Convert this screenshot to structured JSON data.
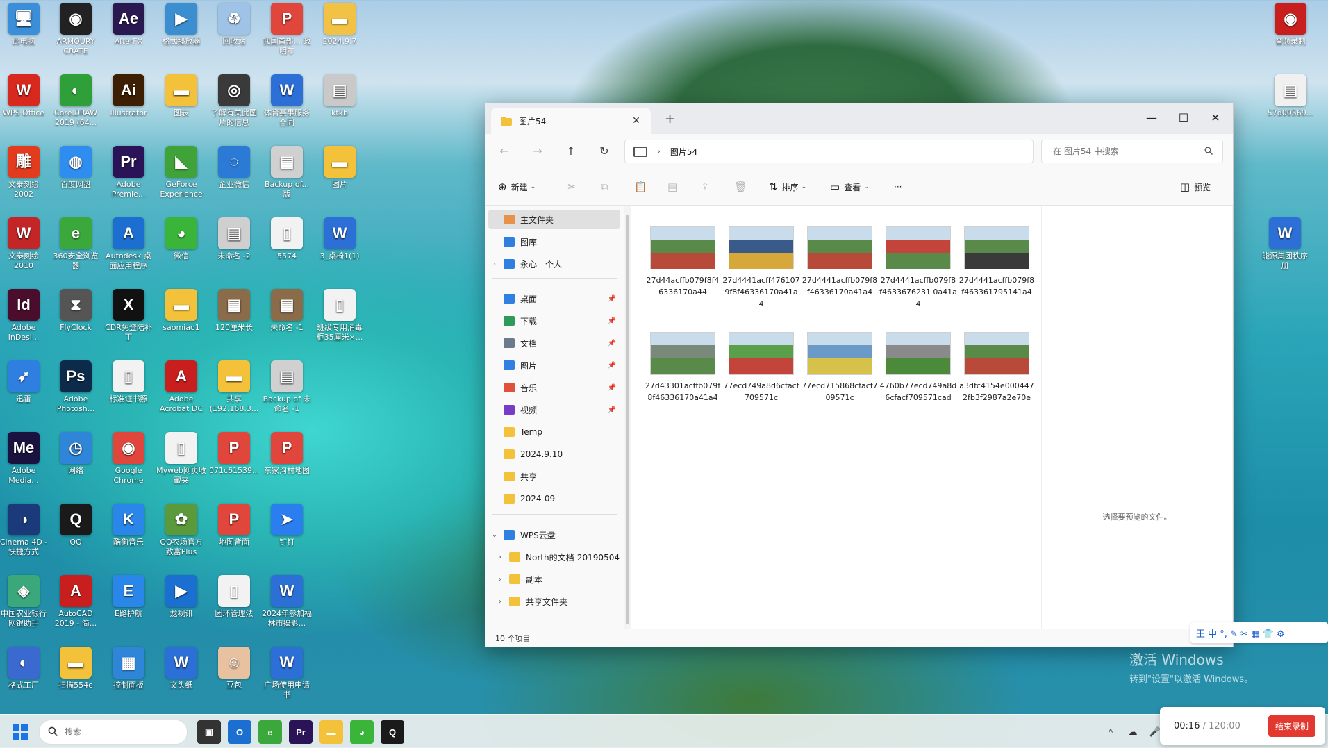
{
  "desktop": {
    "icons": [
      {
        "label": "此电脑",
        "glyph": "🖥",
        "color": "#3a8fd8"
      },
      {
        "label": "ARMOURY CRATE",
        "glyph": "◉",
        "color": "#222222"
      },
      {
        "label": "AfterFX",
        "glyph": "Ae",
        "color": "#2a1850"
      },
      {
        "label": "格式播放器",
        "glyph": "▶",
        "color": "#3b8fd0"
      },
      {
        "label": "回收站",
        "glyph": "♻",
        "color": "#9fc3e6"
      },
      {
        "label": "我国首部... 政 明年",
        "glyph": "P",
        "color": "#e0463c"
      },
      {
        "label": "2024.9.7",
        "glyph": "▬",
        "color": "#f2c244"
      },
      {
        "label": "WPS Office",
        "glyph": "W",
        "color": "#d8291f"
      },
      {
        "label": "CorelDRAW 2019 (64...",
        "glyph": "◐",
        "color": "#2f9f3a"
      },
      {
        "label": "Illustrator",
        "glyph": "Ai",
        "color": "#3d1f04"
      },
      {
        "label": "图表",
        "glyph": "▬",
        "color": "#f3c13a"
      },
      {
        "label": "了解有关此图片的信息",
        "glyph": "◎",
        "color": "#3a3a3a"
      },
      {
        "label": "体育赛事服务合同",
        "glyph": "W",
        "color": "#2c6fd6"
      },
      {
        "label": "ktkb",
        "glyph": "▤",
        "color": "#c9c9c9"
      },
      {
        "label": "文泰刻绘 2002",
        "glyph": "雕",
        "color": "#e33b1d"
      },
      {
        "label": "百度网盘",
        "glyph": "◍",
        "color": "#2f8df0"
      },
      {
        "label": "Adobe Premie...",
        "glyph": "Pr",
        "color": "#2a1457"
      },
      {
        "label": "GeForce Experience",
        "glyph": "◣",
        "color": "#3fa33a"
      },
      {
        "label": "企业微信",
        "glyph": "◌",
        "color": "#2b7ad6"
      },
      {
        "label": "Backup of... 版",
        "glyph": "▤",
        "color": "#d0d0d0"
      },
      {
        "label": "图片",
        "glyph": "▬",
        "color": "#f3c13a"
      },
      {
        "label": "文泰刻绘 2010",
        "glyph": "W",
        "color": "#c42628"
      },
      {
        "label": "360安全浏览器",
        "glyph": "e",
        "color": "#3aa83a"
      },
      {
        "label": "Autodesk 桌面应用程序",
        "glyph": "A",
        "color": "#1c6fd0"
      },
      {
        "label": "微信",
        "glyph": "◕",
        "color": "#3ab53a"
      },
      {
        "label": "未命名 -2",
        "glyph": "▤",
        "color": "#cfcfcf"
      },
      {
        "label": "5574",
        "glyph": "▯",
        "color": "#f2f2f2"
      },
      {
        "label": "3_桌椅1(1)",
        "glyph": "W",
        "color": "#2c6fd6"
      },
      {
        "label": "Adobe InDesi...",
        "glyph": "Id",
        "color": "#4a0d2b"
      },
      {
        "label": "FlyClock",
        "glyph": "⧗",
        "color": "#555555"
      },
      {
        "label": "CDR免登陆补丁",
        "glyph": "X",
        "color": "#111111"
      },
      {
        "label": "saomiao1",
        "glyph": "▬",
        "color": "#f3c13a"
      },
      {
        "label": "120厘米长",
        "glyph": "▤",
        "color": "#8a6b4a"
      },
      {
        "label": "未命名 -1",
        "glyph": "▤",
        "color": "#8a6b4a"
      },
      {
        "label": "班级专用消毒柜35厘米×...",
        "glyph": "▯",
        "color": "#f2f2f2"
      },
      {
        "label": "迅雷",
        "glyph": "➶",
        "color": "#2f7fe0"
      },
      {
        "label": "Adobe Photosh...",
        "glyph": "Ps",
        "color": "#0c2a4a"
      },
      {
        "label": "标准证书照",
        "glyph": "▯",
        "color": "#f2f2f2"
      },
      {
        "label": "Adobe Acrobat DC",
        "glyph": "A",
        "color": "#c81e1e"
      },
      {
        "label": "共享 (192.168.3...",
        "glyph": "▬",
        "color": "#f3c13a"
      },
      {
        "label": "Backup of 未命名 -1",
        "glyph": "▤",
        "color": "#d0d0d0"
      },
      {
        "label": "Adobe Media...",
        "glyph": "Me",
        "color": "#1a1340"
      },
      {
        "label": "网络",
        "glyph": "◷",
        "color": "#2f85d8"
      },
      {
        "label": "Google Chrome",
        "glyph": "◉",
        "color": "#e0463c"
      },
      {
        "label": "Myweb网页收藏夹",
        "glyph": "▯",
        "color": "#f2f2f2"
      },
      {
        "label": "071c61539...",
        "glyph": "P",
        "color": "#e0463c"
      },
      {
        "label": "东家沟村地图",
        "glyph": "P",
        "color": "#e0463c"
      },
      {
        "label": "Cinema 4D - 快捷方式",
        "glyph": "◑",
        "color": "#1a3a7a"
      },
      {
        "label": "QQ",
        "glyph": "Q",
        "color": "#1a1a1a"
      },
      {
        "label": "酷狗音乐",
        "glyph": "K",
        "color": "#2a86e8"
      },
      {
        "label": "QQ农场官方致富Plus",
        "glyph": "✿",
        "color": "#5a9a3a"
      },
      {
        "label": "地图背面",
        "glyph": "P",
        "color": "#e0463c"
      },
      {
        "label": "钉钉",
        "glyph": "➤",
        "color": "#2a7ef0"
      },
      {
        "label": "中国农业银行网银助手",
        "glyph": "◈",
        "color": "#3aa87a"
      },
      {
        "label": "AutoCAD 2019 - 简...",
        "glyph": "A",
        "color": "#c81e1e"
      },
      {
        "label": "E路护航",
        "glyph": "E",
        "color": "#2a86e8"
      },
      {
        "label": "龙视讯",
        "glyph": "▶",
        "color": "#1a6fd0"
      },
      {
        "label": "团环管理法",
        "glyph": "▯",
        "color": "#f2f2f2"
      },
      {
        "label": "2024年参加福林市摄影...",
        "glyph": "W",
        "color": "#2c6fd6"
      },
      {
        "label": "格式工厂",
        "glyph": "◐",
        "color": "#3a6ad0"
      },
      {
        "label": "扫描554e",
        "glyph": "▬",
        "color": "#f3c13a"
      },
      {
        "label": "控制面板",
        "glyph": "▦",
        "color": "#2f85d8"
      },
      {
        "label": "文头纸",
        "glyph": "W",
        "color": "#2c6fd6"
      },
      {
        "label": "豆包",
        "glyph": "☺",
        "color": "#e8c2a0"
      },
      {
        "label": "广场使用申请书",
        "glyph": "W",
        "color": "#2c6fd6"
      },
      {
        "label": "音频录制",
        "glyph": "◉",
        "color": "#c81e1e"
      },
      {
        "label": "57d00569...",
        "glyph": "▤",
        "color": "#f0f0f0"
      },
      {
        "label": "能源集团秩序册",
        "glyph": "W",
        "color": "#2c6fd6"
      }
    ]
  },
  "explorer": {
    "tab_title": "图片54",
    "address_path": "图片54",
    "search_placeholder": "在 图片54 中搜索",
    "toolbar": {
      "new_label": "新建",
      "sort_label": "排序",
      "view_label": "查看",
      "more_label": "···",
      "preview_label": "预览"
    },
    "sidebar": [
      {
        "label": "主文件夹",
        "icon": "home-icon",
        "color": "#e8914a",
        "chev": "",
        "pin": false,
        "selected": true
      },
      {
        "label": "图库",
        "icon": "gallery-icon",
        "color": "#2f7fe0",
        "chev": "",
        "pin": false,
        "selected": false
      },
      {
        "label": "永心 - 个人",
        "icon": "onedrive-icon",
        "color": "#2f7fe0",
        "chev": "›",
        "pin": false,
        "selected": false
      },
      {
        "label": "桌面",
        "icon": "desktop-icon",
        "color": "#2f7fe0",
        "chev": "",
        "pin": true,
        "selected": false
      },
      {
        "label": "下载",
        "icon": "download-icon",
        "color": "#2e9a5a",
        "chev": "",
        "pin": true,
        "selected": false
      },
      {
        "label": "文档",
        "icon": "documents-icon",
        "color": "#6a7a8a",
        "chev": "",
        "pin": true,
        "selected": false
      },
      {
        "label": "图片",
        "icon": "pictures-icon",
        "color": "#2f7fe0",
        "chev": "",
        "pin": true,
        "selected": false
      },
      {
        "label": "音乐",
        "icon": "music-icon",
        "color": "#e0503a",
        "chev": "",
        "pin": true,
        "selected": false
      },
      {
        "label": "视频",
        "icon": "videos-icon",
        "color": "#7a3ac8",
        "chev": "",
        "pin": true,
        "selected": false
      },
      {
        "label": "Temp",
        "icon": "folder-icon",
        "color": "#f3c13a",
        "chev": "",
        "pin": false,
        "selected": false
      },
      {
        "label": "2024.9.10",
        "icon": "folder-icon",
        "color": "#f3c13a",
        "chev": "",
        "pin": false,
        "selected": false
      },
      {
        "label": "共享",
        "icon": "folder-icon",
        "color": "#f3c13a",
        "chev": "",
        "pin": false,
        "selected": false
      },
      {
        "label": "2024-09",
        "icon": "folder-icon",
        "color": "#f3c13a",
        "chev": "",
        "pin": false,
        "selected": false
      },
      {
        "label": "WPS云盘",
        "icon": "cloud-icon",
        "color": "#2f7fe0",
        "chev": "⌄",
        "pin": false,
        "selected": false
      },
      {
        "label": "North的文档-20190504",
        "icon": "folder-icon",
        "color": "#f3c13a",
        "chev": "›",
        "pin": false,
        "selected": false
      },
      {
        "label": "副本",
        "icon": "folder-icon",
        "color": "#f3c13a",
        "chev": "›",
        "pin": false,
        "selected": false
      },
      {
        "label": "共享文件夹",
        "icon": "folder-icon",
        "color": "#f3c13a",
        "chev": "›",
        "pin": false,
        "selected": false
      }
    ],
    "files": [
      {
        "name": "27d44acffb079f8f46336170a44",
        "c1": "#5a8a4a",
        "c2": "#b84a3a"
      },
      {
        "name": "27d4441acff4761079f8f46336170a41a4",
        "c1": "#3a5a8a",
        "c2": "#d6a83a"
      },
      {
        "name": "27d4441acffb079f8f46336170a41a4",
        "c1": "#5a8a4a",
        "c2": "#b84a3a"
      },
      {
        "name": "27d4441acffb079f8f4633676231 0a41a4",
        "c1": "#c2443a",
        "c2": "#5a8a4a"
      },
      {
        "name": "27d4441acffb079f8f463361795141a4",
        "c1": "#5a8a4a",
        "c2": "#3a3a3a"
      },
      {
        "name": "27d43301acffb079f8f46336170a41a4",
        "c1": "#7a8a7a",
        "c2": "#5a8a4a"
      },
      {
        "name": "77ecd749a8d6cfacf709571c",
        "c1": "#5aa04a",
        "c2": "#c2443a"
      },
      {
        "name": "77ecd715868cfacf709571c",
        "c1": "#6a9ac8",
        "c2": "#d6c24a"
      },
      {
        "name": "4760b77ecd749a8d6cfacf709571cad",
        "c1": "#8a8a8a",
        "c2": "#4a8a3a"
      },
      {
        "name": "a3dfc4154e0004472fb3f2987a2e70e",
        "c1": "#5a8a4a",
        "c2": "#b84a3a"
      }
    ],
    "preview_text": "选择要预览的文件。",
    "status_text": "10 个项目"
  },
  "taskbar": {
    "search_placeholder": "搜索",
    "apps": [
      {
        "name": "task-view",
        "glyph": "▣",
        "color": "#333333"
      },
      {
        "name": "outlook",
        "glyph": "O",
        "color": "#1a6fd0"
      },
      {
        "name": "360-browser",
        "glyph": "e",
        "color": "#3aa83a"
      },
      {
        "name": "premiere",
        "glyph": "Pr",
        "color": "#2a1457"
      },
      {
        "name": "file-explorer",
        "glyph": "▬",
        "color": "#f3c13a"
      },
      {
        "name": "wechat",
        "glyph": "◕",
        "color": "#3ab53a"
      },
      {
        "name": "qq",
        "glyph": "Q",
        "color": "#1a1a1a"
      }
    ],
    "tray": [
      "^",
      "☁",
      "🎤"
    ]
  },
  "recorder": {
    "elapsed": "00:16",
    "total": " / 120:00",
    "stop_label": "结束录制"
  },
  "ime_bar": "王 中 °, ✎ ✂ ▦ 👕 ⚙",
  "watermark": {
    "line1": "激活 Windows",
    "line2": "转到\"设置\"以激活 Windows。"
  }
}
